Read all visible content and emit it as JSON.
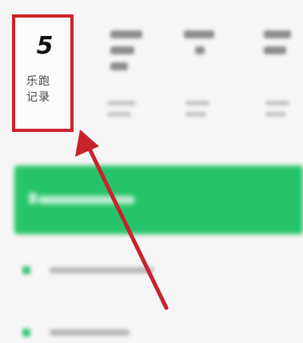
{
  "run_record": {
    "count": "5",
    "label_line1": "乐跑",
    "label_line2": "记录"
  },
  "colors": {
    "highlight": "#d1222b",
    "accent_green": "#26c46a",
    "arrow": "#c7232c"
  }
}
